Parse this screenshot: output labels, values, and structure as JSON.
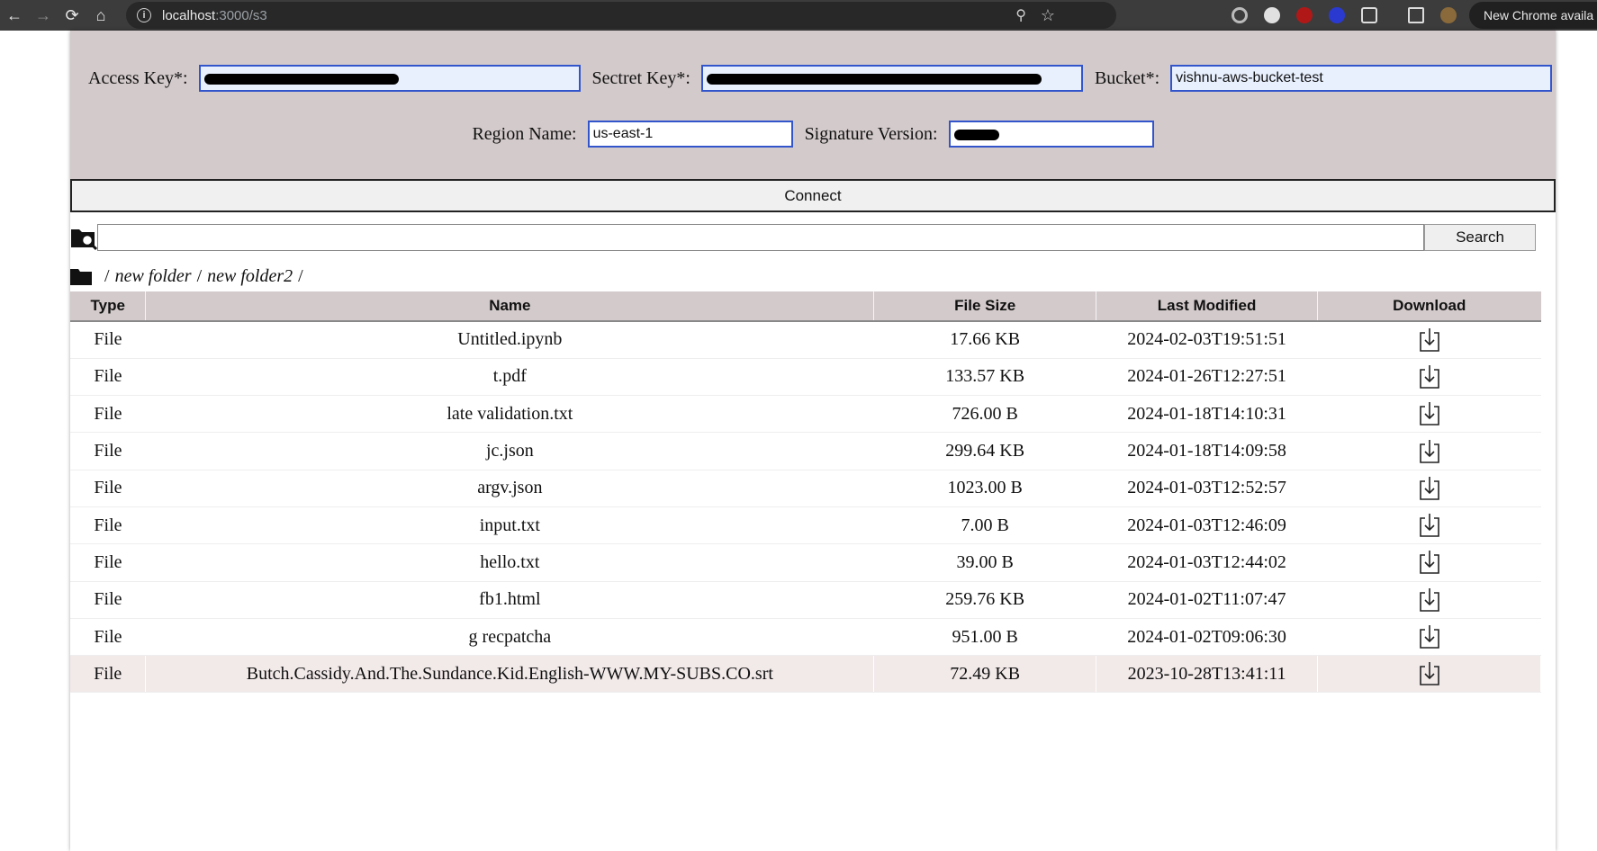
{
  "browser": {
    "url_host": "localhost",
    "url_path": ":3000/s3",
    "new_chrome": "New Chrome availa"
  },
  "form": {
    "access_key_label": "Access Key*:",
    "secret_key_label": "Sectret Key*:",
    "bucket_label": "Bucket*:",
    "bucket_value": "vishnu-aws-bucket-test",
    "region_label": "Region Name:",
    "region_value": "us-east-1",
    "signature_label": "Signature Version:",
    "connect_label": "Connect"
  },
  "search": {
    "button_label": "Search",
    "value": ""
  },
  "breadcrumb": {
    "separator": "/",
    "items": [
      "new folder",
      "new folder2"
    ]
  },
  "table": {
    "columns": [
      "Type",
      "Name",
      "File Size",
      "Last Modified",
      "Download"
    ],
    "rows": [
      {
        "type": "File",
        "name": "Untitled.ipynb",
        "size": "17.66 KB",
        "modified": "2024-02-03T19:51:51"
      },
      {
        "type": "File",
        "name": "t.pdf",
        "size": "133.57 KB",
        "modified": "2024-01-26T12:27:51"
      },
      {
        "type": "File",
        "name": "late validation.txt",
        "size": "726.00 B",
        "modified": "2024-01-18T14:10:31"
      },
      {
        "type": "File",
        "name": "jc.json",
        "size": "299.64 KB",
        "modified": "2024-01-18T14:09:58"
      },
      {
        "type": "File",
        "name": "argv.json",
        "size": "1023.00 B",
        "modified": "2024-01-03T12:52:57"
      },
      {
        "type": "File",
        "name": "input.txt",
        "size": "7.00 B",
        "modified": "2024-01-03T12:46:09"
      },
      {
        "type": "File",
        "name": "hello.txt",
        "size": "39.00 B",
        "modified": "2024-01-03T12:44:02"
      },
      {
        "type": "File",
        "name": "fb1.html",
        "size": "259.76 KB",
        "modified": "2024-01-02T11:07:47"
      },
      {
        "type": "File",
        "name": "g recpatcha",
        "size": "951.00 B",
        "modified": "2024-01-02T09:06:30"
      },
      {
        "type": "File",
        "name": "Butch.Cassidy.And.The.Sundance.Kid.English-WWW.MY-SUBS.CO.srt",
        "size": "72.49 KB",
        "modified": "2023-10-28T13:41:11"
      }
    ]
  },
  "colors": {
    "panel_bg": "#d3cacb",
    "input_border": "#3355cc",
    "row_hover": "#f2e9e9"
  },
  "icons": {
    "download": "download-icon",
    "folder": "folder-icon",
    "search": "folder-search-icon"
  }
}
